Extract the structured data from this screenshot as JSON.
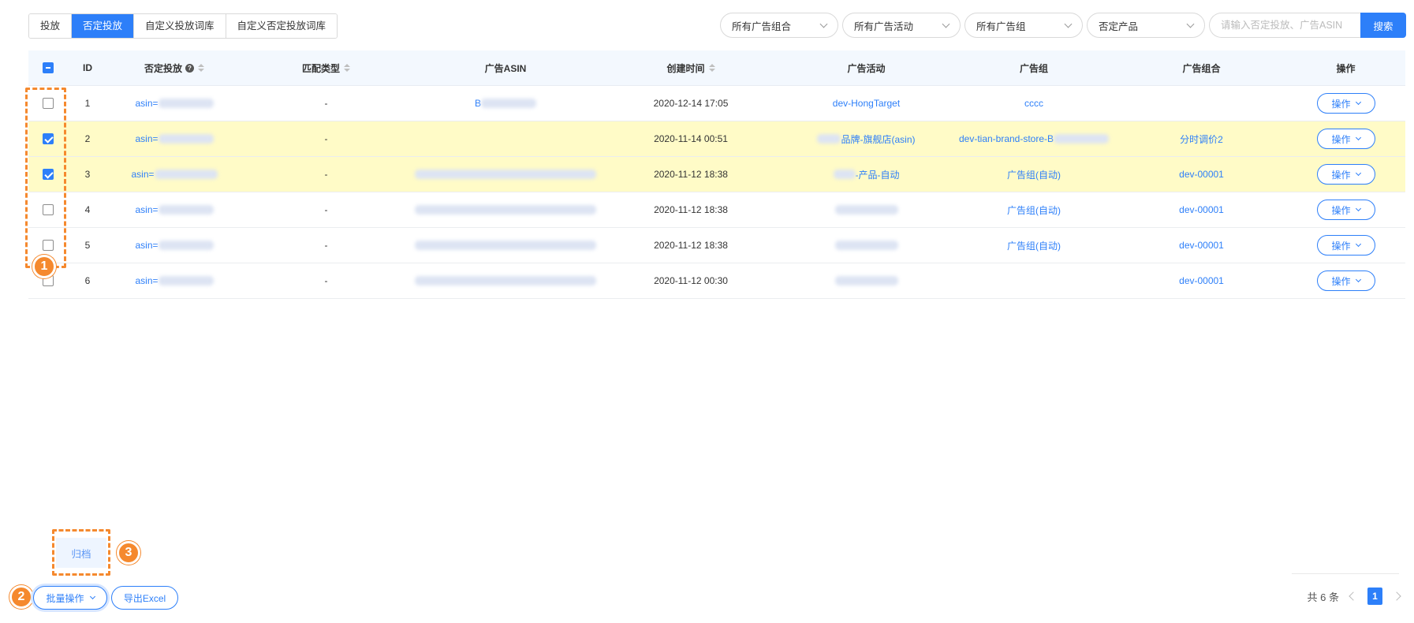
{
  "tabs": [
    {
      "label": "投放",
      "active": false
    },
    {
      "label": "否定投放",
      "active": true
    },
    {
      "label": "自定义投放词库",
      "active": false
    },
    {
      "label": "自定义否定投放词库",
      "active": false
    }
  ],
  "filters": {
    "portfolio": "所有广告组合",
    "campaign": "所有广告活动",
    "ad_group": "所有广告组",
    "negative_product": "否定产品",
    "search_placeholder": "请输入否定投放、广告ASIN",
    "search_button": "搜索"
  },
  "table": {
    "headers": {
      "id": "ID",
      "negative_target": "否定投放",
      "match_type": "匹配类型",
      "ad_asin": "广告ASIN",
      "created_time": "创建时间",
      "campaign": "广告活动",
      "ad_group": "广告组",
      "portfolio": "广告组合",
      "action": "操作"
    },
    "rows": [
      {
        "id": "1",
        "target": "asin=",
        "match": "-",
        "asin": "B",
        "time": "2020-12-14 17:05",
        "campaign": "dev-HongTarget",
        "group": "cccc",
        "portfolio": "",
        "action": "操作",
        "checked": false
      },
      {
        "id": "2",
        "target": "asin=",
        "match": "-",
        "asin": "",
        "time": "2020-11-14 00:51",
        "campaign": "品牌-旗舰店(asin)",
        "group": "dev-tian-brand-store-B",
        "portfolio": "分时调价2",
        "action": "操作",
        "checked": true
      },
      {
        "id": "3",
        "target": "asin=",
        "match": "-",
        "asin": "",
        "time": "2020-11-12 18:38",
        "campaign": "-产品-自动",
        "group": "广告组(自动)",
        "portfolio": "dev-00001",
        "action": "操作",
        "checked": true
      },
      {
        "id": "4",
        "target": "asin=",
        "match": "-",
        "asin": "",
        "time": "2020-11-12 18:38",
        "campaign": "",
        "group": "广告组(自动)",
        "portfolio": "dev-00001",
        "action": "操作",
        "checked": false
      },
      {
        "id": "5",
        "target": "asin=",
        "match": "-",
        "asin": "",
        "time": "2020-11-12 18:38",
        "campaign": "",
        "group": "广告组(自动)",
        "portfolio": "dev-00001",
        "action": "操作",
        "checked": false
      },
      {
        "id": "6",
        "target": "asin=",
        "match": "-",
        "asin": "",
        "time": "2020-11-12 00:30",
        "campaign": "",
        "group": "",
        "portfolio": "dev-00001",
        "action": "操作",
        "checked": false
      }
    ]
  },
  "annotations": {
    "step1": "1",
    "step2": "2",
    "step3": "3"
  },
  "batch_menu": {
    "archive": "归档"
  },
  "footer": {
    "batch_button": "批量操作",
    "export_button": "导出Excel",
    "total": "共 6 条",
    "current_page": "1"
  },
  "colors": {
    "primary": "#2d7ff9",
    "highlight_row": "#fffbc7",
    "annotation": "#f5892e"
  }
}
